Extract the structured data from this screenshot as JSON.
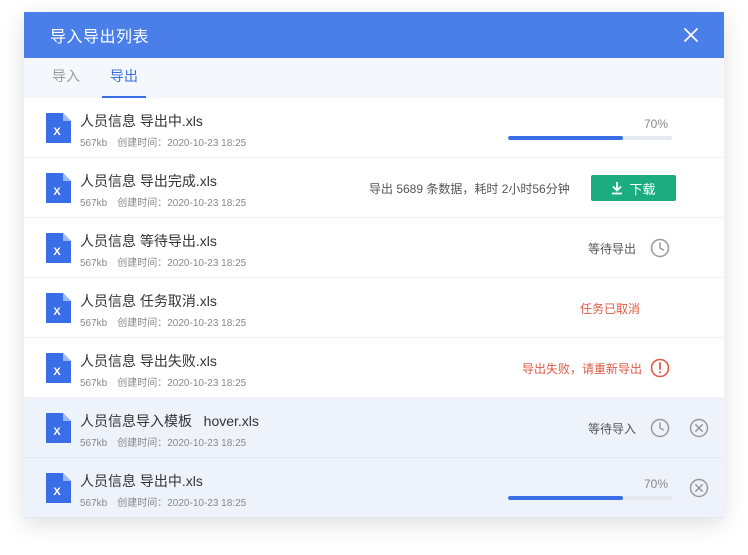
{
  "dialog": {
    "title": "导入导出列表",
    "tabs": [
      {
        "label": "导入",
        "active": false
      },
      {
        "label": "导出",
        "active": true
      }
    ]
  },
  "rows": [
    {
      "file": "人员信息 导出中.xls",
      "size": "567kb",
      "created": "创建时间：2020-10-23 18:25",
      "status": "progress",
      "progress_label": "70%",
      "progress": 0.7
    },
    {
      "file": "人员信息 导出完成.xls",
      "size": "567kb",
      "created": "创建时间：2020-10-23 18:25",
      "status": "done",
      "status_text": "导出 5689 条数据，耗时 2小时56分钟",
      "action_label": "下载"
    },
    {
      "file": "人员信息 等待导出.xls",
      "size": "567kb",
      "created": "创建时间：2020-10-23 18:25",
      "status": "waiting",
      "status_text": "等待导出"
    },
    {
      "file": "人员信息 任务取消.xls",
      "size": "567kb",
      "created": "创建时间：2020-10-23 18:25",
      "status": "cancelled",
      "status_text": "任务已取消"
    },
    {
      "file": "人员信息 导出失败.xls",
      "size": "567kb",
      "created": "创建时间：2020-10-23 18:25",
      "status": "failed",
      "status_text": "导出失败，请重新导出"
    },
    {
      "file": "人员信息导入模板   hover.xls",
      "size": "567kb",
      "created": "创建时间：2020-10-23 18:25",
      "status": "waiting-hover",
      "status_text": "等待导入"
    },
    {
      "file": "人员信息 导出中.xls",
      "size": "567kb",
      "created": "创建时间：2020-10-23 18:25",
      "status": "progress-hover",
      "progress_label": "70%",
      "progress": 0.7
    }
  ],
  "colors": {
    "header": "#4a7ee8",
    "accent": "#3a6ee6",
    "success": "#1bad7e",
    "error": "#e05a47"
  },
  "icons": {
    "file": "excel-file-icon",
    "close": "close-icon",
    "download": "download-icon",
    "clock": "clock-icon",
    "alert": "alert-circle-icon",
    "remove": "remove-circle-icon"
  }
}
